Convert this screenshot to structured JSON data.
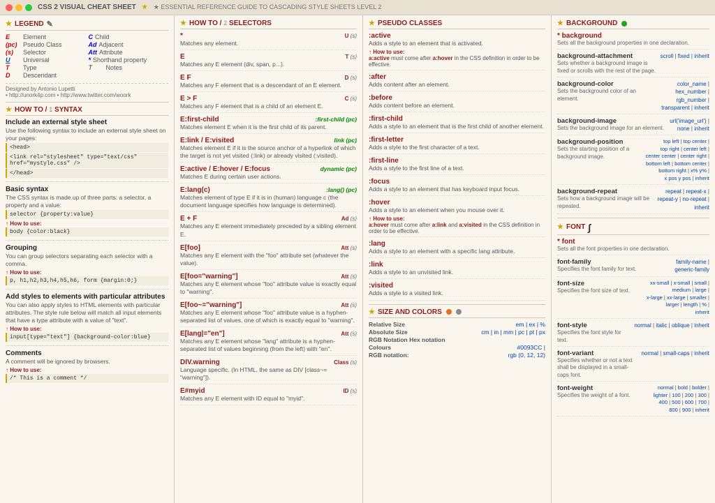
{
  "titlebar": {
    "title": "CSS 2 VISUAL CHEAT SHEET",
    "subtitle": "★ ESSENTIAL REFERENCE GUIDE TO CASCADING STYLE SHEETS LEVEL 2"
  },
  "legend": {
    "header": "LEGEND",
    "items": [
      {
        "abbr": "E",
        "label": "Element",
        "type": "red"
      },
      {
        "abbr": "C",
        "label": "Child",
        "type": "blue"
      },
      {
        "abbr": "(pc)",
        "label": "Pseudo Class",
        "type": "red"
      },
      {
        "abbr": "Ad",
        "label": "Adjacent",
        "type": "blue"
      },
      {
        "abbr": "(s)",
        "label": "Selector",
        "type": "red"
      },
      {
        "abbr": "Att",
        "label": "Attribute",
        "type": "blue"
      },
      {
        "abbr": "U",
        "label": "Universal",
        "type": "blue-u"
      },
      {
        "abbr": "*",
        "label": "Shorthand property",
        "type": "blue"
      },
      {
        "abbr": "T",
        "label": "Type",
        "type": "red"
      },
      {
        "abbr": "T",
        "label": "Notes",
        "type": "normal"
      },
      {
        "abbr": "D",
        "label": "Descendant",
        "type": "red"
      }
    ],
    "designer": "Designed by Antonio Lupetti",
    "links": "• http://unork4p.com • http://www.twitter.com/woork"
  },
  "howto_syntax": {
    "header": "HOW TO",
    "num": "1",
    "label": "SYNTAX",
    "sections": [
      {
        "title": "Include an external style sheet",
        "desc": "Use the following syntax to include an external style sheet on your pages:",
        "code": [
          "<head>",
          "<link rel=\"stylesheet\" type=\"text/css\" href=\"mystyle.css\" />",
          "</head>"
        ]
      },
      {
        "title": "Basic syntax",
        "desc": "The CSS syntax is made up of three parts: a selector, a property and a value:",
        "code": [
          "selector {property:value}"
        ],
        "howto": "How to use:",
        "howto_code": [
          "body {color:black}"
        ]
      },
      {
        "title": "Grouping",
        "desc": "You can group selectors separating each selector with a comma.",
        "howto": "How to use:",
        "howto_code": [
          "p, h1,h2,h3,h4,h5,h6, form {margin:0;}"
        ]
      },
      {
        "title": "Add styles to elements with particular attributes",
        "desc": "You can also apply styles to HTML elements with particular attributes. The style rule below will match all input elements that have a type attribute with a value of \"text\".",
        "howto": "How to use:",
        "howto_code": [
          "input[type=\"text\"] {background-color:blue}"
        ]
      },
      {
        "title": "Comments",
        "desc": "A comment will be ignored by browsers.",
        "howto": "How to use:",
        "howto_code": [
          "/* This is a comment */"
        ]
      }
    ]
  },
  "howto_selectors": {
    "header": "HOW TO",
    "num": "2",
    "label": "SELECTORS",
    "items": [
      {
        "title": "*",
        "desc": "Matches any element.",
        "badge": "U",
        "badge_type": "s"
      },
      {
        "title": "E",
        "desc": "Matches any E element (div, span, p...).",
        "badge": "T",
        "badge_type": "s"
      },
      {
        "title": "E F",
        "desc": "Matches any F element that is a descendant of an E element.",
        "badge": "D",
        "badge_type": "s"
      },
      {
        "title": "E > F",
        "desc": "Matches any F element that is a child of an element E.",
        "badge": "C",
        "badge_type": "s"
      },
      {
        "title": "E:first-child",
        "desc": "Matches element E when it is the first child of its parent.",
        "badge_inline": ":first-child",
        "badge_inline_type": "pc"
      },
      {
        "title": "E:link / E:visited",
        "desc": "Matches element E if it is the source anchor of a hyperlink of which the target is not yet visited (:link) or already visited (:visited).",
        "badge_inline": "link",
        "badge_inline_type": "pc"
      },
      {
        "title": "E:active / E:hover / E:focus",
        "desc": "Matches E during certain user actions.",
        "badge_inline": "dynamic",
        "badge_inline_type": "pc"
      },
      {
        "title": "E:lang(c)",
        "desc": "Matches element of type E if it is in (human) language c (the document language specifies how language is determined).",
        "badge_inline": ":lang()",
        "badge_inline_type": "pc"
      },
      {
        "title": "E + F",
        "desc": "Matches any E element immediately preceded by a sibling element E.",
        "badge": "Ad",
        "badge_type": "s"
      },
      {
        "title": "E[foo]",
        "desc": "Matches any E element with the \"foo\" attribute set (whatever the value).",
        "badge": "Att",
        "badge_type": "s"
      },
      {
        "title": "E[foo=\"warning\"]",
        "desc": "Matches any E element whose \"foo\" attribute value is exactly equal to \"warning\".",
        "badge": "Att",
        "badge_type": "s"
      },
      {
        "title": "E[foo~=\"warning\"]",
        "desc": "Matches any E element whose \"foo\" attribute value is a hyphen-separated list of values beginning (from the left) with \"en\".",
        "badge": "Att",
        "badge_type": "s"
      },
      {
        "title": "E[lang|=\"en\"]",
        "desc": "Matches any E element whose \"lang\" attribute is a hyphen-separated list of values beginning (from the left) with \"en\".",
        "badge": "Att",
        "badge_type": "s"
      },
      {
        "title": "DIV.warning",
        "desc": "Language specific. (In HTML, the same as DIV [class~= \"warning\"]).",
        "badge": "Class",
        "badge_type": "s"
      },
      {
        "title": "E#myid",
        "desc": "Matches any E element with ID equal to \"myid\".",
        "badge": "ID",
        "badge_type": "s"
      }
    ]
  },
  "pseudo_classes": {
    "header": "PSEUDO CLASSES",
    "items": [
      {
        "title": ":active",
        "desc": "Adds a style to an element that is activated."
      },
      {
        "title": ":after",
        "desc": "Adds content after an element."
      },
      {
        "title": ":before",
        "desc": "Adds content before an element."
      },
      {
        "title": ":first-child",
        "desc": "Adds a style to an element that is the first child of another element."
      },
      {
        "title": ":first-letter",
        "desc": "Adds a style to the first character of a text."
      },
      {
        "title": ":first-line",
        "desc": "Adds a style to the first line of a text."
      },
      {
        "title": ":focus",
        "desc": "Adds a style to an element that has keyboard input focus."
      },
      {
        "title": ":hover",
        "desc": "Adds a style to an element when you mouse over it.",
        "howto": "How to use:",
        "howto_desc": "a:hover must come after a:link and a:visited in the CSS definition in order to be effective."
      },
      {
        "title": ":lang",
        "desc": "Adds a style to an element with a specific lang attribute."
      },
      {
        "title": ":link",
        "desc": "Adds a style to an unvisited link."
      },
      {
        "title": ":visited",
        "desc": "Adds a style to a visited link."
      }
    ],
    "active_howto": "How to use:",
    "active_howto_desc": "a:active must come after a:hover in the CSS definition in order to be effective."
  },
  "size_colors": {
    "header": "SIZE AND COLORS",
    "rows": [
      {
        "label": "Relative Size",
        "values": "em | ex | %"
      },
      {
        "label": "Absolute Size",
        "values": "cm | in | mm | pc | pt | px"
      },
      {
        "label": "RGB Notation Hex notation"
      },
      {
        "label": "Colours",
        "values": "#0093CC |"
      },
      {
        "label": "RGB notation:",
        "values": "rgb (0, 12, 12)"
      }
    ]
  },
  "background": {
    "header": "BACKGROUND",
    "props": [
      {
        "title": "* background",
        "is_main": true,
        "desc": "Sets all the background properties in one declaration.",
        "values": ""
      },
      {
        "title": "background-attachment",
        "desc": "Sets whether a background image is fixed or scrolls with the rest of the page.",
        "values": "scroll | fixed | inherit"
      },
      {
        "title": "background-color",
        "desc": "Sets the background color of an element.",
        "values": "color_name |\nhex_number |\nrgb_number |\ntransparent | inherit"
      },
      {
        "title": "background-image",
        "desc": "Sets the background image for an element.",
        "values": "url('image_url') |\nnone | inherit"
      },
      {
        "title": "background-position",
        "desc": "Sets the starting position of a background image.",
        "values": "top left | top center |\ntop right | center left |\ncenter center | center right |\nbottom left | bottom center |\nbottom right | x% y% |\nx pos y pos | inherit"
      },
      {
        "title": "background-repeat",
        "desc": "Sets how a background image will be repeated.",
        "values": "repeat | repeat-x |\nrepeat-y | no-repeat |\ninherit"
      }
    ]
  },
  "font": {
    "header": "FONT",
    "props": [
      {
        "title": "* font",
        "is_main": true,
        "desc": "Sets all the font properties in one declaration.",
        "values": ""
      },
      {
        "title": "font-family",
        "desc": "Specifies the font family for text.",
        "values": "family-name |\ngeneric-family"
      },
      {
        "title": "font-size",
        "desc": "Specifies the font size of text.",
        "values": "xx-small | x-small | small |\nmedium | large |\nx-large | xx-large | smaller |\nlarger | length | % |\ninherit"
      },
      {
        "title": "font-style",
        "desc": "Specifies the font style for text.",
        "values": "normal | italic | oblique | inherit"
      },
      {
        "title": "font-variant",
        "desc": "Specifies whether or not a text shall be displayed in a small-caps font.",
        "values": "normal | small-caps | inherit"
      },
      {
        "title": "font-weight",
        "desc": "Specifies the weight of a font.",
        "values": "normal | bold | bolder |\nlighter | 100 | 200 | 300 |\n400 | 500 | 600 | 700 |\n800 | 900 | inherit"
      }
    ]
  }
}
